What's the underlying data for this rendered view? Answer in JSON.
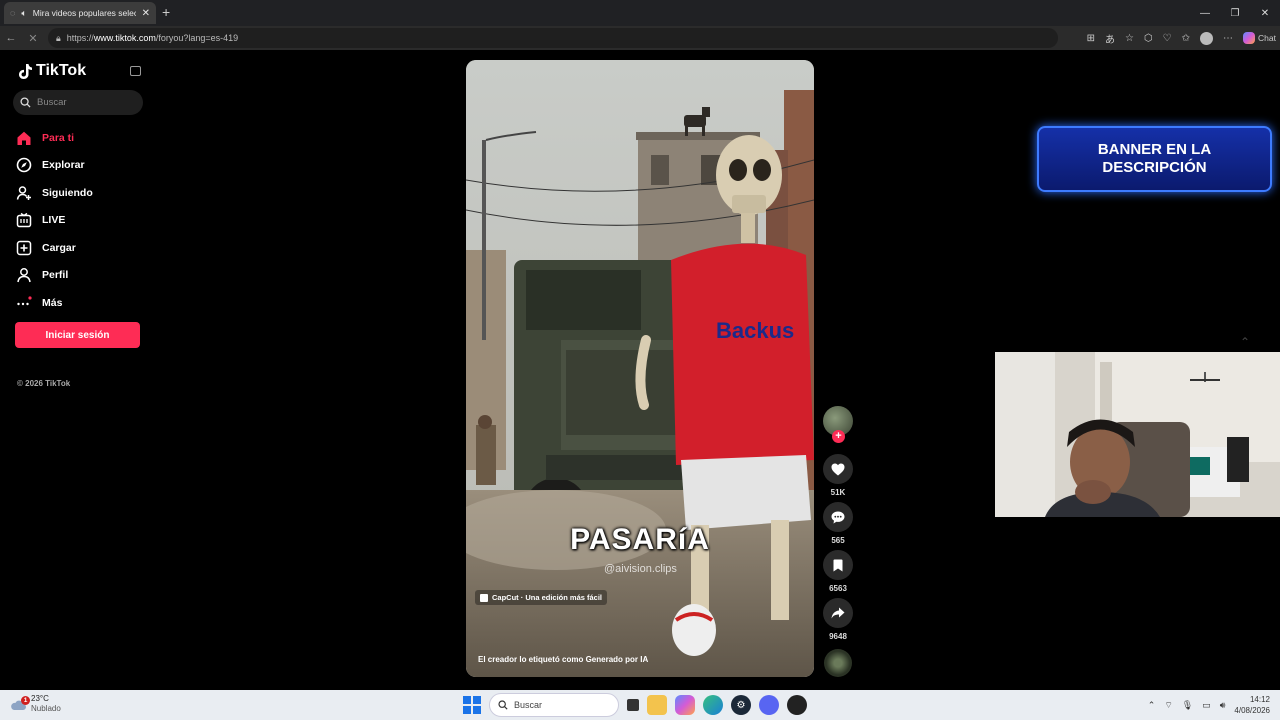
{
  "browser": {
    "tab_title": "Mira videos populares selecci",
    "url_prefix": "https://",
    "url_host": "www.tiktok.com",
    "url_path": "/foryou?lang=es-419",
    "chat_label": "Chat"
  },
  "sidebar": {
    "logo_text": "TikTok",
    "search_placeholder": "Buscar",
    "items": [
      {
        "label": "Para ti",
        "icon": "home-icon",
        "active": true
      },
      {
        "label": "Explorar",
        "icon": "compass-icon"
      },
      {
        "label": "Siguiendo",
        "icon": "following-icon"
      },
      {
        "label": "LIVE",
        "icon": "live-icon"
      },
      {
        "label": "Cargar",
        "icon": "upload-icon"
      },
      {
        "label": "Perfil",
        "icon": "profile-icon"
      },
      {
        "label": "Más",
        "icon": "more-icon"
      }
    ],
    "login_label": "Iniciar sesión",
    "copyright": "© 2026 TikTok"
  },
  "video": {
    "overlay_caption": "PASARíA",
    "watermark_handle": "@aivision.clips",
    "capcut_label": "CapCut · Una edición más fácil",
    "ai_label": "El creador lo etiquetó como Generado por IA",
    "jersey_text": "Backus"
  },
  "actions": {
    "likes": "51K",
    "comments": "565",
    "saves": "6563",
    "shares": "9648"
  },
  "banner": {
    "text": "BANNER EN LA\nDESCRIPCIÓN"
  },
  "taskbar": {
    "temperature": "23°C",
    "condition": "Nublado",
    "weather_badge": "1",
    "search_placeholder": "Buscar",
    "time": "14:12",
    "date": "4/08/2026"
  },
  "colors": {
    "tiktok_accent": "#fe2c55",
    "banner_blue": "#1530a8"
  }
}
